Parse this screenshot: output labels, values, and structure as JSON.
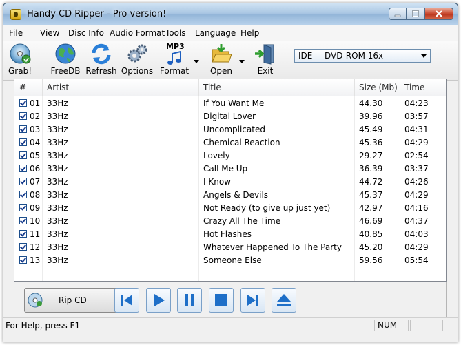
{
  "window": {
    "title": "Handy CD Ripper - Pro version!"
  },
  "menu": [
    "File",
    "View",
    "Disc Info",
    "Audio Format",
    "Tools",
    "Language",
    "Help"
  ],
  "toolbar": {
    "grab": "Grab!",
    "freedb": "FreeDB",
    "refresh": "Refresh",
    "options": "Options",
    "format_badge": "MP3",
    "format": "Format",
    "open": "Open",
    "exit": "Exit"
  },
  "drive": {
    "type": "IDE",
    "name": "DVD-ROM 16x"
  },
  "columns": {
    "num": "#",
    "artist": "Artist",
    "title": "Title",
    "size": "Size (Mb)",
    "time": "Time"
  },
  "tracks": [
    {
      "num": "01",
      "artist": "33Hz",
      "title": "If You Want Me",
      "size": "44.30",
      "time": "04:23",
      "checked": true
    },
    {
      "num": "02",
      "artist": "33Hz",
      "title": "Digital Lover",
      "size": "39.96",
      "time": "03:57",
      "checked": true
    },
    {
      "num": "03",
      "artist": "33Hz",
      "title": "Uncomplicated",
      "size": "45.49",
      "time": "04:31",
      "checked": true
    },
    {
      "num": "04",
      "artist": "33Hz",
      "title": "Chemical Reaction",
      "size": "45.36",
      "time": "04:29",
      "checked": true
    },
    {
      "num": "05",
      "artist": "33Hz",
      "title": "Lovely",
      "size": "29.27",
      "time": "02:54",
      "checked": true
    },
    {
      "num": "06",
      "artist": "33Hz",
      "title": "Call Me Up",
      "size": "36.39",
      "time": "03:37",
      "checked": true
    },
    {
      "num": "07",
      "artist": "33Hz",
      "title": "I Know",
      "size": "44.72",
      "time": "04:26",
      "checked": true
    },
    {
      "num": "08",
      "artist": "33Hz",
      "title": "Angels & Devils",
      "size": "45.37",
      "time": "04:29",
      "checked": true
    },
    {
      "num": "09",
      "artist": "33Hz",
      "title": "Not Ready (to give up just yet)",
      "size": "42.97",
      "time": "04:16",
      "checked": true
    },
    {
      "num": "10",
      "artist": "33Hz",
      "title": "Crazy All The Time",
      "size": "46.69",
      "time": "04:37",
      "checked": true
    },
    {
      "num": "11",
      "artist": "33Hz",
      "title": "Hot Flashes",
      "size": "40.85",
      "time": "04:03",
      "checked": true
    },
    {
      "num": "12",
      "artist": "33Hz",
      "title": "Whatever Happened To The Party",
      "size": "45.20",
      "time": "04:29",
      "checked": true
    },
    {
      "num": "13",
      "artist": "33Hz",
      "title": "Someone Else",
      "size": "59.56",
      "time": "05:54",
      "checked": true
    }
  ],
  "player": {
    "rip_label": "Rip CD",
    "controls": [
      "previous-track-icon",
      "play-icon",
      "pause-icon",
      "stop-icon",
      "next-track-icon",
      "eject-icon"
    ]
  },
  "status": {
    "help": "For Help, press F1",
    "num": "NUM"
  },
  "colors": {
    "accent": "#1e6fc8",
    "titlebar": "#a9c6e3",
    "close": "#c8452b"
  }
}
